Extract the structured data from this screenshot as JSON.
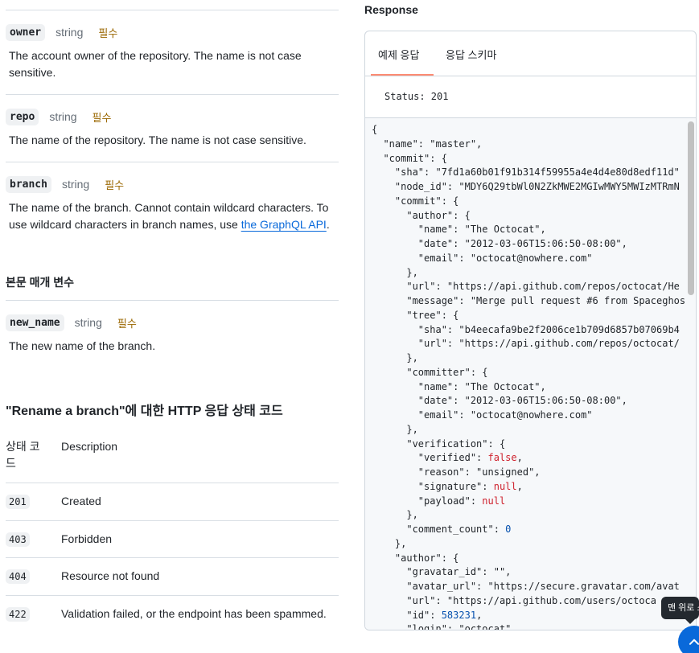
{
  "path_params": [
    {
      "name": "owner",
      "type": "string",
      "required": "필수",
      "desc": "The account owner of the repository. The name is not case sensitive."
    },
    {
      "name": "repo",
      "type": "string",
      "required": "필수",
      "desc": "The name of the repository. The name is not case sensitive."
    },
    {
      "name": "branch",
      "type": "string",
      "required": "필수",
      "desc_prefix": "The name of the branch. Cannot contain wildcard characters. To use wildcard characters in branch names, use ",
      "desc_link": "the GraphQL API",
      "desc_suffix": "."
    }
  ],
  "body_params_heading": "본문 매개 변수",
  "body_params": [
    {
      "name": "new_name",
      "type": "string",
      "required": "필수",
      "desc": "The new name of the branch."
    }
  ],
  "status_section": {
    "heading": "\"Rename a branch\"에 대한 HTTP 응답 상태 코드",
    "col_code": "상태 코드",
    "col_desc": "Description",
    "rows": [
      {
        "code": "201",
        "desc": "Created"
      },
      {
        "code": "403",
        "desc": "Forbidden"
      },
      {
        "code": "404",
        "desc": "Resource not found"
      },
      {
        "code": "422",
        "desc": "Validation failed, or the endpoint has been spammed."
      }
    ]
  },
  "response": {
    "title": "Response",
    "tabs": [
      "예제 응답",
      "응답 스키마"
    ],
    "active_tab": "예제 응답",
    "status_text": "Status: 201",
    "json_lines": [
      "{",
      "  \"name\": \"master\",",
      "  \"commit\": {",
      "    \"sha\": \"7fd1a60b01f91b314f59955a4e4d4e80d8edf11d\"",
      "    \"node_id\": \"MDY6Q29tbWl0N2ZkMWE2MGIwMWY5MWIzMTRmN",
      "    \"commit\": {",
      "      \"author\": {",
      "        \"name\": \"The Octocat\",",
      "        \"date\": \"2012-03-06T15:06:50-08:00\",",
      "        \"email\": \"octocat@nowhere.com\"",
      "      },",
      "      \"url\": \"https://api.github.com/repos/octocat/He",
      "      \"message\": \"Merge pull request #6 from Spaceghos",
      "      \"tree\": {",
      "        \"sha\": \"b4eecafa9be2f2006ce1b709d6857b07069b4",
      "        \"url\": \"https://api.github.com/repos/octocat/",
      "      },",
      "      \"committer\": {",
      "        \"name\": \"The Octocat\",",
      "        \"date\": \"2012-03-06T15:06:50-08:00\",",
      "        \"email\": \"octocat@nowhere.com\"",
      "      },",
      "      \"verification\": {",
      "        \"verified\": false,",
      "        \"reason\": \"unsigned\",",
      "        \"signature\": null,",
      "        \"payload\": null",
      "      },",
      "      \"comment_count\": 0",
      "    },",
      "    \"author\": {",
      "      \"gravatar_id\": \"\",",
      "      \"avatar_url\": \"https://secure.gravatar.com/avat",
      "      \"url\": \"https://api.github.com/users/octoca",
      "      \"id\": 583231,",
      "      \"login\": \"octocat\""
    ]
  },
  "back_to_top": {
    "tooltip": "맨 위로 스"
  },
  "colors": {
    "link": "#0969da",
    "required": "#9a6700",
    "tab_underline": "#fd8c73",
    "button": "#0969da"
  }
}
